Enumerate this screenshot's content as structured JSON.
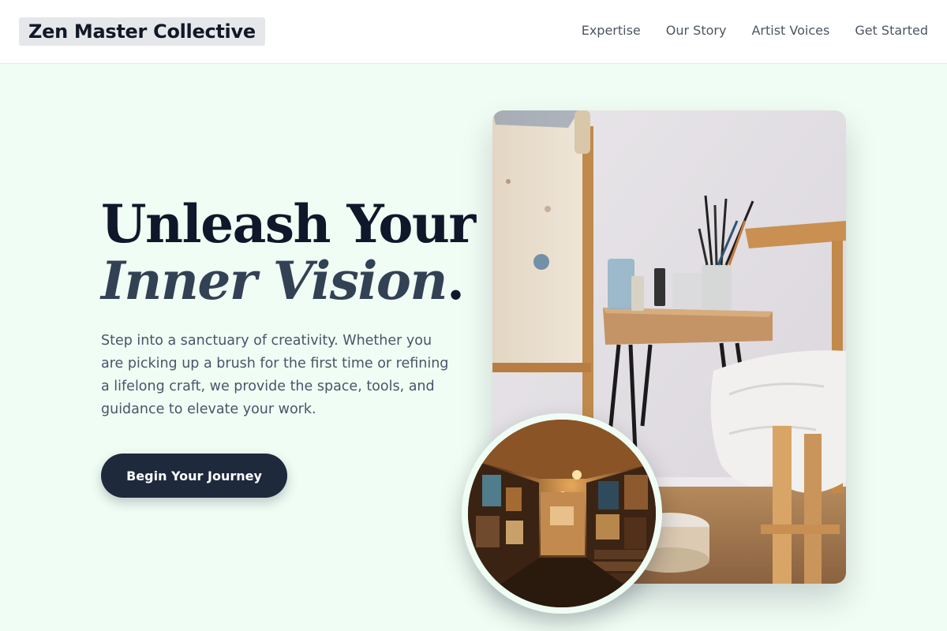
{
  "header": {
    "brand": "Zen Master Collective",
    "nav": [
      "Expertise",
      "Our Story",
      "Artist Voices",
      "Get Started"
    ]
  },
  "hero": {
    "title_line1": "Unleash Your",
    "title_line2": "Inner Vision",
    "title_punct": ".",
    "description": "Step into a sanctuary of creativity. Whether you are picking up a brush for the first time or refining a lifelong craft, we provide the space, tools, and guidance to elevate your work.",
    "cta_label": "Begin Your Journey"
  },
  "colors": {
    "background": "#f0fdf4",
    "heading": "#0f172a",
    "accent_italic": "#334155",
    "button": "#1e293b"
  }
}
